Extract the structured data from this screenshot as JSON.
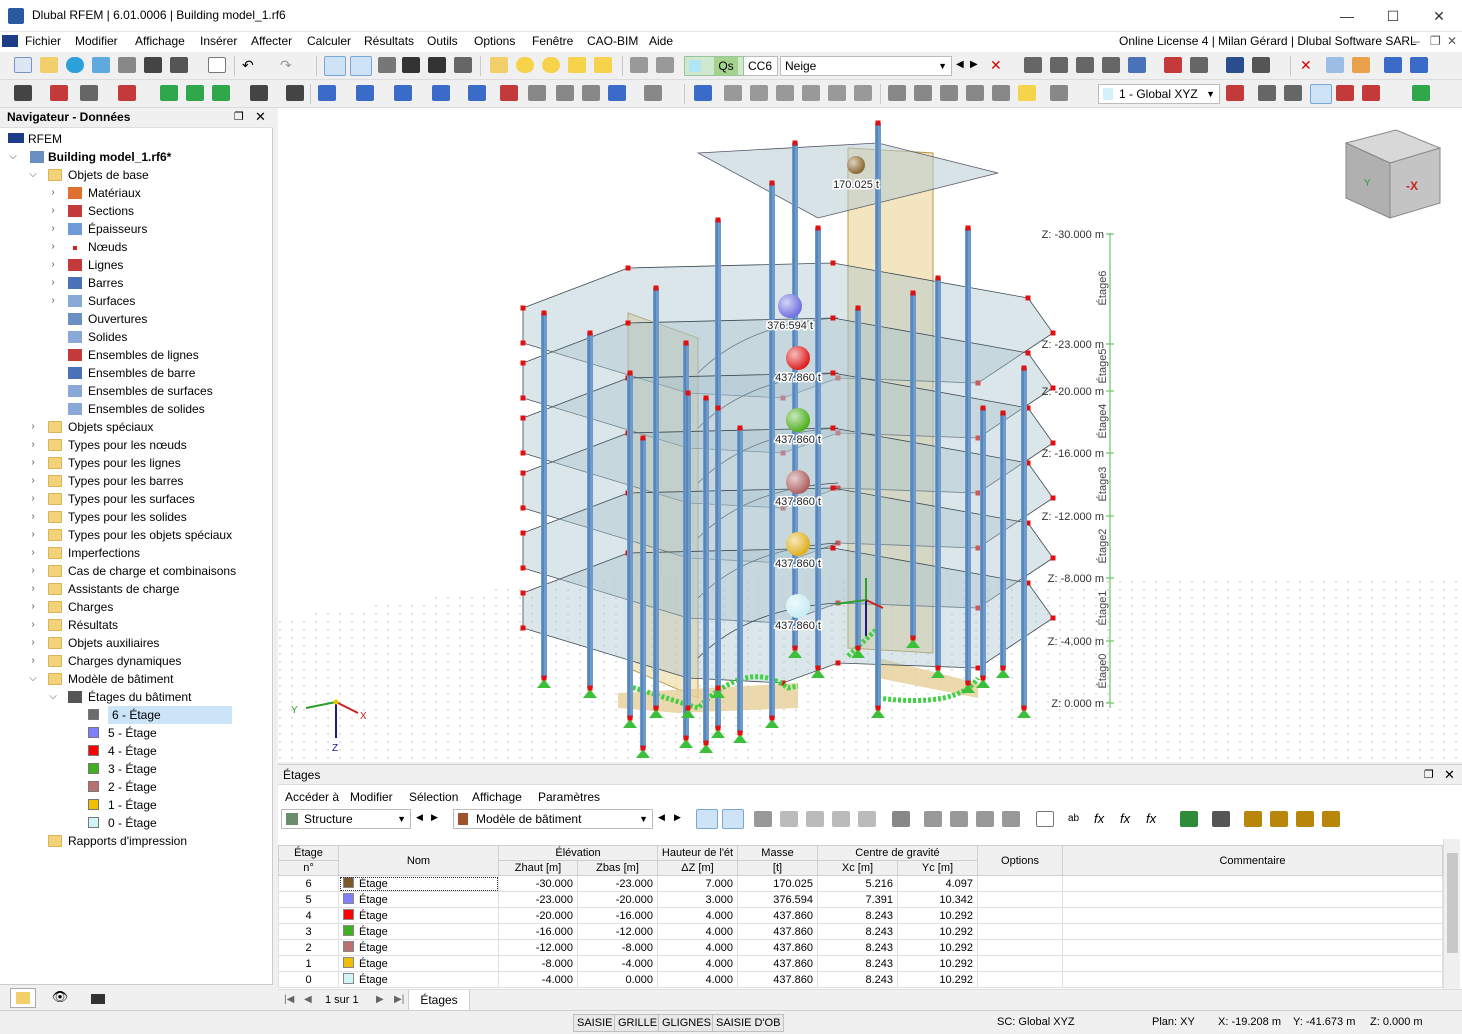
{
  "window": {
    "title": "Dlubal RFEM | 6.01.0006 | Building model_1.rf6",
    "minimize": "—",
    "maximize": "☐",
    "close": "✕"
  },
  "menu": {
    "items": [
      "Fichier",
      "Modifier",
      "Affichage",
      "Insérer",
      "Affecter",
      "Calculer",
      "Résultats",
      "Outils",
      "Options",
      "Fenêtre",
      "CAO-BIM",
      "Aide"
    ],
    "license": "Online License 4 | Milan Gérard | Dlubal Software SARL"
  },
  "toolbar": {
    "loadcase_tag": "Qs",
    "loadcase_id": "CC6",
    "loadcase_name": "Neige",
    "coord_system": "1 - Global XYZ"
  },
  "navigator": {
    "title": "Navigateur - Données",
    "root": "RFEM",
    "model": "Building model_1.rf6*",
    "items": [
      {
        "label": "Objets de base",
        "level": 1,
        "expanded": true,
        "icon": "folder-icon"
      },
      {
        "label": "Matériaux",
        "level": 2,
        "icon": "materials-icon"
      },
      {
        "label": "Sections",
        "level": 2,
        "icon": "sections-icon"
      },
      {
        "label": "Épaisseurs",
        "level": 2,
        "icon": "thickness-icon"
      },
      {
        "label": "Nœuds",
        "level": 2,
        "icon": "node-icon"
      },
      {
        "label": "Lignes",
        "level": 2,
        "icon": "line-icon"
      },
      {
        "label": "Barres",
        "level": 2,
        "icon": "member-icon"
      },
      {
        "label": "Surfaces",
        "level": 2,
        "icon": "surface-icon"
      },
      {
        "label": "Ouvertures",
        "level": 2,
        "leaf": true,
        "icon": "opening-icon"
      },
      {
        "label": "Solides",
        "level": 2,
        "leaf": true,
        "icon": "solid-icon"
      },
      {
        "label": "Ensembles de lignes",
        "level": 2,
        "leaf": true,
        "icon": "line-set-icon"
      },
      {
        "label": "Ensembles de barre",
        "level": 2,
        "leaf": true,
        "icon": "member-set-icon"
      },
      {
        "label": "Ensembles de surfaces",
        "level": 2,
        "leaf": true,
        "icon": "surface-set-icon"
      },
      {
        "label": "Ensembles de solides",
        "level": 2,
        "leaf": true,
        "icon": "solid-set-icon"
      },
      {
        "label": "Objets spéciaux",
        "level": 1,
        "icon": "folder-icon"
      },
      {
        "label": "Types pour les nœuds",
        "level": 1,
        "icon": "folder-icon"
      },
      {
        "label": "Types pour les lignes",
        "level": 1,
        "icon": "folder-icon"
      },
      {
        "label": "Types pour les barres",
        "level": 1,
        "icon": "folder-icon"
      },
      {
        "label": "Types pour les surfaces",
        "level": 1,
        "icon": "folder-icon"
      },
      {
        "label": "Types pour les solides",
        "level": 1,
        "icon": "folder-icon"
      },
      {
        "label": "Types pour les objets spéciaux",
        "level": 1,
        "icon": "folder-icon"
      },
      {
        "label": "Imperfections",
        "level": 1,
        "icon": "folder-icon"
      },
      {
        "label": "Cas de charge et combinaisons",
        "level": 1,
        "icon": "folder-icon"
      },
      {
        "label": "Assistants de charge",
        "level": 1,
        "icon": "folder-icon"
      },
      {
        "label": "Charges",
        "level": 1,
        "icon": "folder-icon"
      },
      {
        "label": "Résultats",
        "level": 1,
        "icon": "folder-icon"
      },
      {
        "label": "Objets auxiliaires",
        "level": 1,
        "icon": "folder-icon"
      },
      {
        "label": "Charges dynamiques",
        "level": 1,
        "icon": "folder-icon"
      },
      {
        "label": "Modèle de bâtiment",
        "level": 1,
        "expanded": true,
        "icon": "folder-icon"
      },
      {
        "label": "Étages du bâtiment",
        "level": 2,
        "expanded": true,
        "icon": "stories-icon"
      },
      {
        "label": "6 - Étage",
        "level": 3,
        "leaf": true,
        "swatch": "#6b6b6b",
        "selected": true
      },
      {
        "label": "5 - Étage",
        "level": 3,
        "leaf": true,
        "swatch": "#8080ff"
      },
      {
        "label": "4 - Étage",
        "level": 3,
        "leaf": true,
        "swatch": "#ff0000"
      },
      {
        "label": "3 - Étage",
        "level": 3,
        "leaf": true,
        "swatch": "#40b020"
      },
      {
        "label": "2 - Étage",
        "level": 3,
        "leaf": true,
        "swatch": "#b87070"
      },
      {
        "label": "1 - Étage",
        "level": 3,
        "leaf": true,
        "swatch": "#f0c000"
      },
      {
        "label": "0 - Étage",
        "level": 3,
        "leaf": true,
        "swatch": "#d0f4f8"
      },
      {
        "label": "Rapports d'impression",
        "level": 1,
        "leaf": true,
        "icon": "folder-icon"
      }
    ]
  },
  "viewport": {
    "mass_labels": [
      "170.025 t",
      "376.594 t",
      "437.860 t",
      "437.860 t",
      "437.860 t",
      "437.860 t",
      "437.860 t"
    ],
    "mass_colors": [
      "#8a6a30",
      "#7070e0",
      "#e02020",
      "#50b020",
      "#b06060",
      "#e0b020",
      "#c8eef4"
    ],
    "level_labels": [
      "Z: -30.000 m",
      "Z: -23.000 m",
      "Z: -20.000 m",
      "Z: -16.000 m",
      "Z: -12.000 m",
      "Z: -8.000 m",
      "Z: -4.000 m",
      "Z: 0.000 m"
    ],
    "story_labels": [
      "Étage6",
      "Étage5",
      "Étage4",
      "Étage3",
      "Étage2",
      "Étage1",
      "Étage0"
    ],
    "axes": {
      "x": "X",
      "y": "Y",
      "z": "Z"
    },
    "cube": {
      "y_label": "Y",
      "x_label": "-X"
    }
  },
  "panel": {
    "title": "Étages",
    "menu": [
      "Accéder à",
      "Modifier",
      "Sélection",
      "Affichage",
      "Paramètres"
    ],
    "combo_structure": "Structure",
    "combo_model": "Modèle de bâtiment",
    "headers": {
      "story": "Étage",
      "story_no": "n°",
      "name": "Nom",
      "elevation": "Élévation",
      "z_top": "Zhaut [m]",
      "z_bottom": "Zbas [m]",
      "height_group": "Hauteur de l'ét",
      "height": "ΔZ [m]",
      "mass_group": "Masse",
      "mass": "[t]",
      "cog": "Centre de gravité",
      "xc": "Xc [m]",
      "yc": "Yc [m]",
      "options": "Options",
      "comment": "Commentaire"
    },
    "rows": [
      {
        "no": "6",
        "color": "#7a5a2a",
        "name": "Étage",
        "ztop": "-30.000",
        "zbot": "-23.000",
        "dz": "7.000",
        "mass": "170.025",
        "xc": "5.216",
        "yc": "4.097"
      },
      {
        "no": "5",
        "color": "#8080ff",
        "name": "Étage",
        "ztop": "-23.000",
        "zbot": "-20.000",
        "dz": "3.000",
        "mass": "376.594",
        "xc": "7.391",
        "yc": "10.342"
      },
      {
        "no": "4",
        "color": "#ff0000",
        "name": "Étage",
        "ztop": "-20.000",
        "zbot": "-16.000",
        "dz": "4.000",
        "mass": "437.860",
        "xc": "8.243",
        "yc": "10.292"
      },
      {
        "no": "3",
        "color": "#40b020",
        "name": "Étage",
        "ztop": "-16.000",
        "zbot": "-12.000",
        "dz": "4.000",
        "mass": "437.860",
        "xc": "8.243",
        "yc": "10.292"
      },
      {
        "no": "2",
        "color": "#b87070",
        "name": "Étage",
        "ztop": "-12.000",
        "zbot": "-8.000",
        "dz": "4.000",
        "mass": "437.860",
        "xc": "8.243",
        "yc": "10.292"
      },
      {
        "no": "1",
        "color": "#f0c000",
        "name": "Étage",
        "ztop": "-8.000",
        "zbot": "-4.000",
        "dz": "4.000",
        "mass": "437.860",
        "xc": "8.243",
        "yc": "10.292"
      },
      {
        "no": "0",
        "color": "#d0f4f8",
        "name": "Étage",
        "ztop": "-4.000",
        "zbot": "0.000",
        "dz": "4.000",
        "mass": "437.860",
        "xc": "8.243",
        "yc": "10.292"
      }
    ],
    "pager": "1 sur 1",
    "tab": "Étages"
  },
  "statusbar": {
    "buttons": [
      "SAISIE",
      "GRILLE",
      "GLIGNES",
      "SAISIE D'OB"
    ],
    "sc": "SC: Global XYZ",
    "plan": "Plan: XY",
    "x": "X: -19.208 m",
    "y": "Y: -41.673 m",
    "z": "Z: 0.000 m"
  }
}
